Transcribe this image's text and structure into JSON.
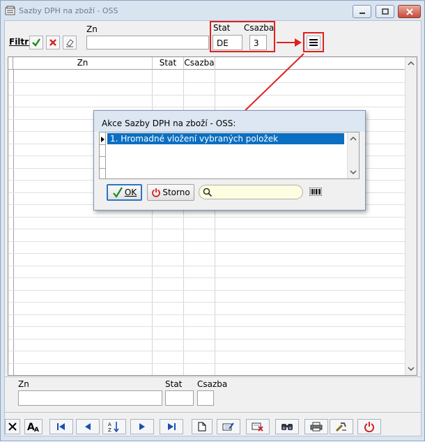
{
  "window": {
    "title": "Sazby DPH na zboží - OSS"
  },
  "filter": {
    "label": "Filtr:",
    "zn_label": "Zn",
    "stat_label": "Stat",
    "csazba_label": "Csazba",
    "zn_value": "",
    "stat_value": "DE",
    "csazba_value": "3"
  },
  "grid": {
    "columns": [
      "Zn",
      "Stat",
      "Csazba"
    ]
  },
  "dialog": {
    "title": "Akce Sazby DPH na zboží - OSS:",
    "items": [
      "1. Hromadné vložení vybraných položek"
    ],
    "ok_label": "OK",
    "storno_label": "Storno",
    "search_value": ""
  },
  "detail": {
    "zn_label": "Zn",
    "stat_label": "Stat",
    "csazba_label": "Csazba"
  },
  "colors": {
    "accent": "#0a6fc2",
    "annotation": "#e02020",
    "search_bg": "#fffde0"
  }
}
